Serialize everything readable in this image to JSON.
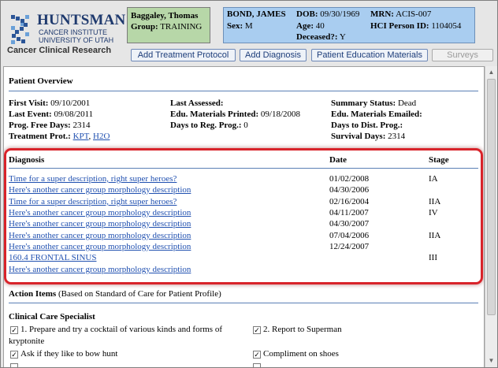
{
  "logo": {
    "name": "HUNTSMAN",
    "line1": "CANCER INSTITUTE",
    "line2": "UNIVERSITY OF UTAH",
    "tagline": "Cancer Clinical Research"
  },
  "patient_box": {
    "name": "Baggaley, Thomas",
    "group_label": "Group:",
    "group_value": "TRAINING"
  },
  "demographics": {
    "name": "BOND, JAMES",
    "dob_label": "DOB:",
    "dob": "09/30/1969",
    "mrn_label": "MRN:",
    "mrn": "ACIS-007",
    "sex_label": "Sex:",
    "sex": "M",
    "age_label": "Age:",
    "age": "40",
    "hci_label": "HCI Person ID:",
    "hci": "1104054",
    "deceased_label": "Deceased?:",
    "deceased": "Y"
  },
  "buttons": {
    "add_treatment": "Add Treatment Protocol",
    "add_diagnosis": "Add Diagnosis",
    "education": "Patient Education Materials",
    "surveys": "Surveys"
  },
  "overview": {
    "title": "Patient Overview",
    "first_visit_label": "First Visit:",
    "first_visit": "09/10/2001",
    "last_event_label": "Last Event:",
    "last_event": "09/08/2011",
    "pfd_label": "Prog. Free Days:",
    "pfd": "2314",
    "treatment_label": "Treatment Prot.:",
    "treatment_links": [
      "KPT",
      "H2O"
    ],
    "treatment_sep": ",",
    "last_assessed_label": "Last Assessed:",
    "last_assessed": "",
    "edu_printed_label": "Edu. Materials Printed:",
    "edu_printed": "09/18/2008",
    "days_reg_label": "Days to Reg. Prog.:",
    "days_reg": "0",
    "summary_label": "Summary Status:",
    "summary": "Dead",
    "edu_emailed_label": "Edu. Materials Emailed:",
    "edu_emailed": "",
    "days_dist_label": "Days to Dist. Prog.:",
    "days_dist": "",
    "survival_label": "Survival Days:",
    "survival": "2314"
  },
  "diagnosis": {
    "headers": {
      "diagnosis": "Diagnosis",
      "date": "Date",
      "stage": "Stage"
    },
    "rows": [
      {
        "desc": "Time for a super description, right super heroes?",
        "date": "01/02/2008",
        "stage": "IA"
      },
      {
        "desc": "Here's another cancer group morphology description",
        "date": "04/30/2006",
        "stage": ""
      },
      {
        "desc": "Time for a super description, right super heroes?",
        "date": "02/16/2004",
        "stage": "IIA"
      },
      {
        "desc": "Here's another cancer group morphology description",
        "date": "04/11/2007",
        "stage": "IV"
      },
      {
        "desc": "Here's another cancer group morphology description",
        "date": "04/30/2007",
        "stage": ""
      },
      {
        "desc": "Here's another cancer group morphology description",
        "date": "07/04/2006",
        "stage": "IIA"
      },
      {
        "desc": "Here's another cancer group morphology description",
        "date": "12/24/2007",
        "stage": ""
      },
      {
        "desc": "160.4 FRONTAL SINUS",
        "date": "",
        "stage": "III"
      },
      {
        "desc": "Here's another cancer group morphology description",
        "date": "",
        "stage": ""
      }
    ]
  },
  "action_items": {
    "title": "Action Items",
    "note": "(Based on Standard of Care for Patient Profile)"
  },
  "clinical_care": {
    "title": "Clinical Care Specialist",
    "items": [
      {
        "label": "1. Prepare and try a cocktail of various kinds and forms of",
        "label2": "kryptonite",
        "checked": true
      },
      {
        "label": "2. Report to Superman",
        "checked": true
      },
      {
        "label": "Ask if they like to bow hunt",
        "checked": true
      },
      {
        "label": "Compliment on shoes",
        "checked": true
      }
    ],
    "check_glyph": "✓"
  },
  "colors": {
    "highlight": "#d8232a",
    "link": "#2050b0",
    "patient_box": "#b7d7a8",
    "demographics_box": "#a9cdf0",
    "rule": "#5a7fb5"
  }
}
